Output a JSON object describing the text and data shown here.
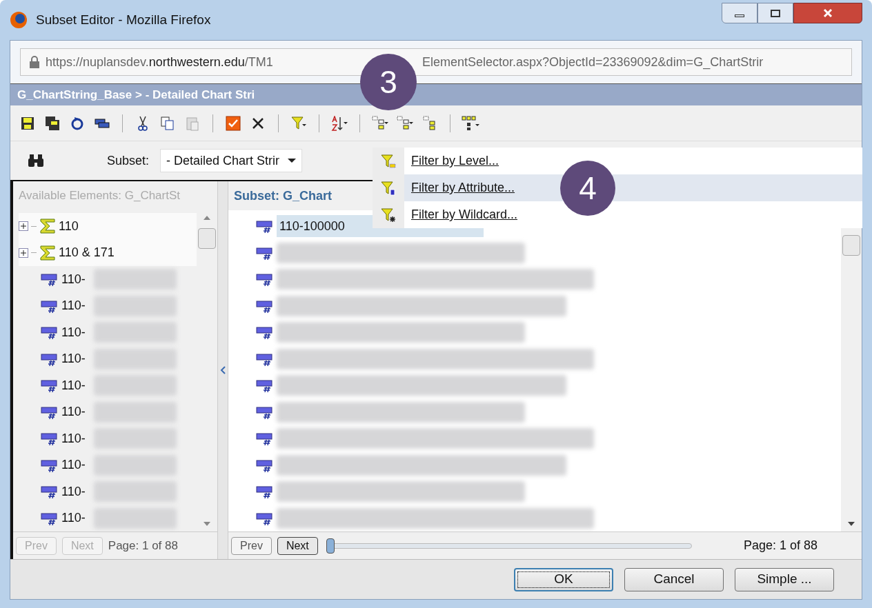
{
  "window": {
    "title": "Subset Editor - Mozilla Firefox"
  },
  "address_bar": {
    "url_parts": [
      "https://nuplansdev.**northwestern.edu**/TM1",
      "ElementSelector.aspx?ObjectId=23369092&dim=G_ChartStrir"
    ]
  },
  "breadcrumb": "G_ChartString_Base > - Detailed Chart Stri",
  "subset_row": {
    "label": "Subset:",
    "value": "- Detailed Chart Strir"
  },
  "filter_menu": [
    {
      "label": "Filter by Level...",
      "selected": false
    },
    {
      "label": "Filter by Attribute...",
      "selected": true
    },
    {
      "label": "Filter by Wildcard...",
      "selected": false
    }
  ],
  "available_panel": {
    "title": "Available Elements: G_ChartSt",
    "items": [
      {
        "kind": "consolidated",
        "label": "110",
        "expanded": false
      },
      {
        "kind": "consolidated",
        "label": "110 & 171",
        "expanded": false
      },
      {
        "kind": "leaf",
        "label": "110-"
      },
      {
        "kind": "leaf",
        "label": "110-"
      },
      {
        "kind": "leaf",
        "label": "110-"
      },
      {
        "kind": "leaf",
        "label": "110-"
      },
      {
        "kind": "leaf",
        "label": "110-"
      },
      {
        "kind": "leaf",
        "label": "110-"
      },
      {
        "kind": "leaf",
        "label": "110-"
      },
      {
        "kind": "leaf",
        "label": "110-"
      },
      {
        "kind": "leaf",
        "label": "110-"
      },
      {
        "kind": "leaf",
        "label": "110-"
      }
    ],
    "pager": {
      "prev": "Prev",
      "next": "Next",
      "page": "Page: 1 of 88",
      "disabled": true
    }
  },
  "subset_panel": {
    "title": "Subset: G_Chart",
    "items": [
      {
        "label": "110-100000",
        "selected": true
      },
      {
        "selected": false
      },
      {
        "selected": false
      },
      {
        "selected": false
      },
      {
        "selected": false
      },
      {
        "selected": false
      },
      {
        "selected": false
      },
      {
        "selected": false
      },
      {
        "selected": false
      },
      {
        "selected": false
      },
      {
        "selected": false
      },
      {
        "selected": false
      }
    ],
    "pager": {
      "prev": "Prev",
      "next": "Next",
      "page": "Page: 1 of 88",
      "disabled": false,
      "level": 0
    }
  },
  "buttons": [
    {
      "label": "OK",
      "default": true
    },
    {
      "label": "Cancel",
      "default": false
    },
    {
      "label": "Simple ...",
      "default": false
    }
  ],
  "callouts": [
    "3",
    "4"
  ]
}
